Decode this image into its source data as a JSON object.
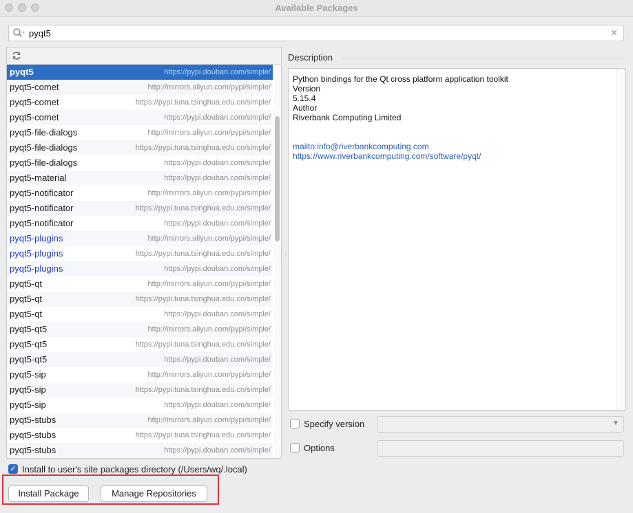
{
  "window": {
    "title": "Available Packages"
  },
  "search": {
    "value": "pyqt5"
  },
  "packages": [
    {
      "name": "pyqt5",
      "repo": "https://pypi.douban.com/simple/",
      "selected": true,
      "link": false
    },
    {
      "name": "pyqt5-comet",
      "repo": "http://mirrors.aliyun.com/pypi/simple/",
      "link": false
    },
    {
      "name": "pyqt5-comet",
      "repo": "https://pypi.tuna.tsinghua.edu.cn/simple/",
      "link": false
    },
    {
      "name": "pyqt5-comet",
      "repo": "https://pypi.douban.com/simple/",
      "link": false
    },
    {
      "name": "pyqt5-file-dialogs",
      "repo": "http://mirrors.aliyun.com/pypi/simple/",
      "link": false
    },
    {
      "name": "pyqt5-file-dialogs",
      "repo": "https://pypi.tuna.tsinghua.edu.cn/simple/",
      "link": false
    },
    {
      "name": "pyqt5-file-dialogs",
      "repo": "https://pypi.douban.com/simple/",
      "link": false
    },
    {
      "name": "pyqt5-material",
      "repo": "https://pypi.douban.com/simple/",
      "link": false
    },
    {
      "name": "pyqt5-notificator",
      "repo": "http://mirrors.aliyun.com/pypi/simple/",
      "link": false
    },
    {
      "name": "pyqt5-notificator",
      "repo": "https://pypi.tuna.tsinghua.edu.cn/simple/",
      "link": false
    },
    {
      "name": "pyqt5-notificator",
      "repo": "https://pypi.douban.com/simple/",
      "link": false
    },
    {
      "name": "pyqt5-plugins",
      "repo": "http://mirrors.aliyun.com/pypi/simple/",
      "link": true
    },
    {
      "name": "pyqt5-plugins",
      "repo": "https://pypi.tuna.tsinghua.edu.cn/simple/",
      "link": true
    },
    {
      "name": "pyqt5-plugins",
      "repo": "https://pypi.douban.com/simple/",
      "link": true
    },
    {
      "name": "pyqt5-qt",
      "repo": "http://mirrors.aliyun.com/pypi/simple/",
      "link": false
    },
    {
      "name": "pyqt5-qt",
      "repo": "https://pypi.tuna.tsinghua.edu.cn/simple/",
      "link": false
    },
    {
      "name": "pyqt5-qt",
      "repo": "https://pypi.douban.com/simple/",
      "link": false
    },
    {
      "name": "pyqt5-qt5",
      "repo": "http://mirrors.aliyun.com/pypi/simple/",
      "link": false
    },
    {
      "name": "pyqt5-qt5",
      "repo": "https://pypi.tuna.tsinghua.edu.cn/simple/",
      "link": false
    },
    {
      "name": "pyqt5-qt5",
      "repo": "https://pypi.douban.com/simple/",
      "link": false
    },
    {
      "name": "pyqt5-sip",
      "repo": "http://mirrors.aliyun.com/pypi/simple/",
      "link": false
    },
    {
      "name": "pyqt5-sip",
      "repo": "https://pypi.tuna.tsinghua.edu.cn/simple/",
      "link": false
    },
    {
      "name": "pyqt5-sip",
      "repo": "https://pypi.douban.com/simple/",
      "link": false
    },
    {
      "name": "pyqt5-stubs",
      "repo": "http://mirrors.aliyun.com/pypi/simple/",
      "link": false
    },
    {
      "name": "pyqt5-stubs",
      "repo": "https://pypi.tuna.tsinghua.edu.cn/simple/",
      "link": false
    },
    {
      "name": "pyqt5-stubs",
      "repo": "https://pypi.douban.com/simple/",
      "link": false
    }
  ],
  "description": {
    "label": "Description",
    "summary": "Python bindings for the Qt cross platform application toolkit",
    "version_label": "Version",
    "version": "5.15.4",
    "author_label": "Author",
    "author": "Riverbank Computing Limited",
    "email_link": "mailto:info@riverbankcomputing.com",
    "homepage_link": "https://www.riverbankcomputing.com/software/pyqt/"
  },
  "options": {
    "specify_version_label": "Specify version",
    "specify_version_checked": false,
    "options_label": "Options",
    "options_checked": false,
    "user_site_label": "Install to user's site packages directory (/Users/wq/.local)",
    "user_site_checked": true
  },
  "buttons": {
    "install": "Install Package",
    "manage": "Manage Repositories"
  },
  "colors": {
    "selection": "#2d6fc6",
    "highlight_box": "#e0313a",
    "link": "#1d35d6"
  }
}
